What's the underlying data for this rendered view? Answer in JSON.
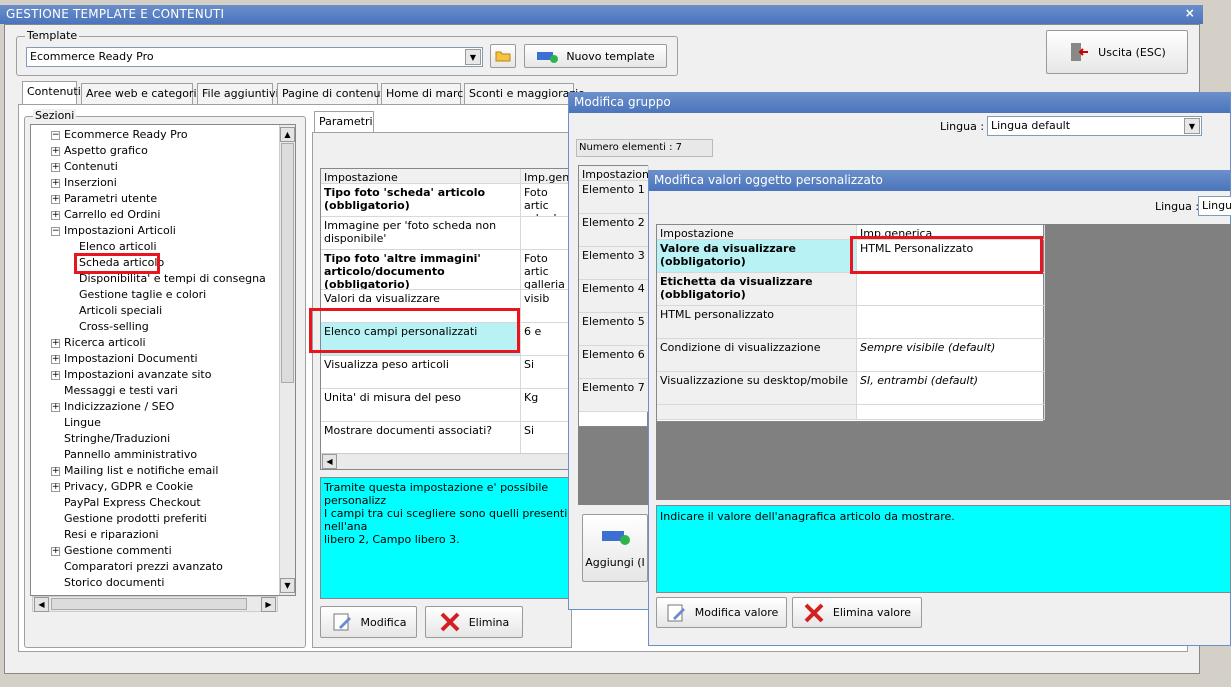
{
  "window": {
    "title": "GESTIONE TEMPLATE E CONTENUTI",
    "close": "×"
  },
  "template": {
    "legend": "Template",
    "selected": "Ecommerce Ready Pro",
    "new_label": "Nuovo template",
    "exit_label": "Uscita (ESC)"
  },
  "tabs": [
    "Contenuti",
    "Aree web e categorie",
    "File aggiuntivi",
    "Pagine di contenuti",
    "Home di marca",
    "Sconti e maggiorazio"
  ],
  "sections": {
    "legend": "Sezioni",
    "items": [
      {
        "label": "Ecommerce Ready Pro",
        "exp": "−"
      },
      {
        "label": "Aspetto grafico",
        "exp": "+"
      },
      {
        "label": "Contenuti",
        "exp": "+"
      },
      {
        "label": "Inserzioni",
        "exp": "+"
      },
      {
        "label": "Parametri utente",
        "exp": "+"
      },
      {
        "label": "Carrello ed Ordini",
        "exp": "+"
      },
      {
        "label": "Impostazioni Articoli",
        "exp": "−"
      },
      {
        "label": "Elenco articoli",
        "exp": ""
      },
      {
        "label": "Scheda articolo",
        "exp": ""
      },
      {
        "label": "Disponibilita' e tempi di consegna",
        "exp": ""
      },
      {
        "label": "Gestione taglie e colori",
        "exp": ""
      },
      {
        "label": "Articoli speciali",
        "exp": ""
      },
      {
        "label": "Cross-selling",
        "exp": ""
      },
      {
        "label": "Ricerca articoli",
        "exp": "+"
      },
      {
        "label": "Impostazioni Documenti",
        "exp": "+"
      },
      {
        "label": "Impostazioni avanzate sito",
        "exp": "+"
      },
      {
        "label": "Messaggi e testi vari",
        "exp": ""
      },
      {
        "label": "Indicizzazione / SEO",
        "exp": "+"
      },
      {
        "label": "Lingue",
        "exp": ""
      },
      {
        "label": "Stringhe/Traduzioni",
        "exp": ""
      },
      {
        "label": "Pannello amministrativo",
        "exp": ""
      },
      {
        "label": "Mailing list e notifiche email",
        "exp": "+"
      },
      {
        "label": "Privacy, GDPR e Cookie",
        "exp": "+"
      },
      {
        "label": "PayPal Express Checkout",
        "exp": ""
      },
      {
        "label": "Gestione prodotti preferiti",
        "exp": ""
      },
      {
        "label": "Resi e riparazioni",
        "exp": ""
      },
      {
        "label": "Gestione commenti",
        "exp": "+"
      },
      {
        "label": "Comparatori prezzi avanzato",
        "exp": ""
      },
      {
        "label": "Storico documenti",
        "exp": ""
      }
    ]
  },
  "params": {
    "tab": "Parametri",
    "header": [
      "Impostazione",
      "Imp.gene"
    ],
    "rows": [
      {
        "k": "Tipo foto 'scheda' articolo (obbligatorio)",
        "v": "Foto artic scheda"
      },
      {
        "k": "Immagine per 'foto scheda non disponibile'",
        "v": ""
      },
      {
        "k": "Tipo foto 'altre immagini' articolo/documento (obbligatorio)",
        "v": "Foto artic galleria"
      },
      {
        "k": "Valori da visualizzare",
        "v": "visib"
      },
      {
        "k": "Elenco campi personalizzati",
        "v": "6 e"
      },
      {
        "k": "Visualizza peso articoli",
        "v": "Si"
      },
      {
        "k": "Unita' di misura del peso",
        "v": "Kg"
      },
      {
        "k": "Mostrare documenti associati?",
        "v": "Si"
      }
    ],
    "description": "Tramite questa impostazione e' possibile personalizz\nI campi tra cui scegliere sono quelli presenti nell'ana\nlibero 2, Campo libero 3.",
    "modify": "Modifica",
    "delete": "Elimina"
  },
  "group_dialog": {
    "title": "Modifica gruppo",
    "lang_label": "Lingua :",
    "lang_value": "Lingua default",
    "count": "Numero elementi : 7",
    "header": "Impostazione",
    "elements": [
      "Elemento 1",
      "Elemento 2",
      "Elemento 3",
      "Elemento 4",
      "Elemento 5",
      "Elemento 6",
      "Elemento 7"
    ],
    "add": "Aggiungi (I"
  },
  "custom_dialog": {
    "title": "Modifica valori oggetto personalizzato",
    "lang_label": "Lingua :",
    "lang_value": "Lingua",
    "header": [
      "Impostazione",
      "Imp.generica"
    ],
    "rows": [
      {
        "k": "Valore da visualizzare (obbligatorio)",
        "v": "HTML Personalizzato"
      },
      {
        "k": "Etichetta da visualizzare (obbligatorio)",
        "v": ""
      },
      {
        "k": "HTML personalizzato",
        "v": ""
      },
      {
        "k": "Condizione di visualizzazione",
        "v": "Sempre visibile (default)"
      },
      {
        "k": "Visualizzazione su desktop/mobile",
        "v": "SI, entrambi (default)"
      }
    ],
    "description": "Indicare il valore dell'anagrafica articolo da mostrare.",
    "modify": "Modifica valore",
    "delete": "Elimina valore"
  }
}
